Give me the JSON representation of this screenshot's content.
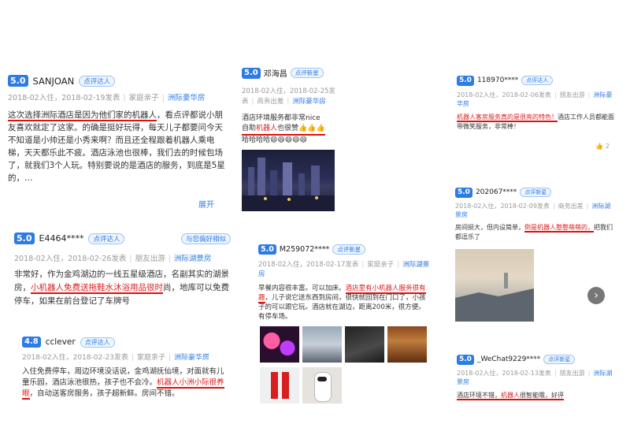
{
  "accent": "#2d7be5",
  "highlight": "#e01b1b",
  "card1": {
    "score": "5.0",
    "user": "SANJOAN",
    "badge": "点评达人",
    "checkin": "2018-02入住，",
    "posted": "2018-02-19发表",
    "trip": "家庭亲子",
    "room": "洲际豪华房",
    "line1": "这次选择洲际酒店是因为他们家的机器人",
    "line1b": "，看点评都说小朋友喜欢就定了这家。的确是挺好玩得，每天儿子都要问今天不知道是小帅还是小秀来啊？而且还全程跟着机器人乘电梯，天天都乐此不疲。酒店泳池也很棒，我们去的时候包场了，就我们3个人玩。特别要说的是酒店的服务，到底是5星的，…",
    "more": "展开"
  },
  "card2": {
    "score": "5.0",
    "user": "E4464****",
    "badge": "点评达人",
    "tag": "与您偏好相似",
    "checkin": "2018-02入住，",
    "posted": "2018-02-26发表",
    "trip": "朋友出游",
    "room": "洲际湖景房",
    "text_a": "非常好，作为金鸡湖边的一线五星级酒店，名副其实的湖景房，",
    "highlight": "小机器人免费送拖鞋水沐浴用品很时",
    "text_b": "尚，地库可以免费停车，如果在前台登记了车牌号"
  },
  "card3": {
    "score": "4.8",
    "user": "cclever",
    "badge": "点评达人",
    "checkin": "2018-02入住，",
    "posted": "2018-02-23发表",
    "trip": "家庭亲子",
    "room": "洲际豪华房",
    "text_a": "入住免费停车，周边环境没话说，金鸡湖抚仙境，对面就有儿童乐园，酒店泳池很热，孩子也不会冷。",
    "highlight": "机器人小洲小际很养眼",
    "text_b": "，自动送客房服务，孩子超新鲜。房间不错。"
  },
  "card4": {
    "score": "5.0",
    "user": "邓海昌",
    "badge": "点评新星",
    "checkin": "2018-02入住，",
    "posted": "2018-02-25发表",
    "trip": "商务出差",
    "room": "洲际豪华房",
    "text_a": "酒店环境服务都非常nice",
    "highlight_prefix": "自助",
    "highlight": "机器人",
    "highlight_suffix": "也很赞",
    "emoji1": "👍👍👍",
    "text_b": "哈哈哈哈",
    "emoji2": "😄😄😄😄😄"
  },
  "card5": {
    "score": "5.0",
    "user": "M259072****",
    "badge": "点评新星",
    "checkin": "2018-02入住，",
    "posted": "2018-02-17发表",
    "trip": "家庭亲子",
    "room": "洲际湖景房",
    "text_a": "早餐内容很丰富。可以加床。",
    "highlight": "酒店里有小机器人服务很有趣",
    "text_b": "，儿子说它送东西到房间，很快就回到在门口了，小孩子的可以跟它玩。酒店就在湖边，距离200米，很方便。有停车场。"
  },
  "card6": {
    "score": "5.0",
    "user": "118970****",
    "badge": "点评达人",
    "checkin": "2018-02入住，",
    "posted": "2018-02-06发表",
    "trip": "朋友出游",
    "room": "洲际豪华房",
    "highlight": "机器人客房服务真的是很亮的特色！",
    "text_b": "酒店工作人员都能面带微笑服务，非常棒！",
    "likes": "2"
  },
  "card7": {
    "score": "5.0",
    "user": "202067****",
    "badge": "点评新星",
    "checkin": "2018-02入住，",
    "posted": "2018-02-09发表",
    "trip": "商务出差",
    "room": "洲际湖景房",
    "text_a": "房间挺大，但内设简单，",
    "highlight": "倒是机器人憨憨萌萌的，",
    "text_b": "把我们都逗乐了"
  },
  "card8": {
    "score": "5.0",
    "user": "_WeChat9229****",
    "badge": "点评新星",
    "checkin": "2018-02入住，",
    "posted": "2018-02-13发表",
    "trip": "朋友出游",
    "room": "洲际湖景房",
    "text_a": "酒店环境不错，",
    "highlight": "机器人",
    "text_b": "很智能哦，好评"
  }
}
